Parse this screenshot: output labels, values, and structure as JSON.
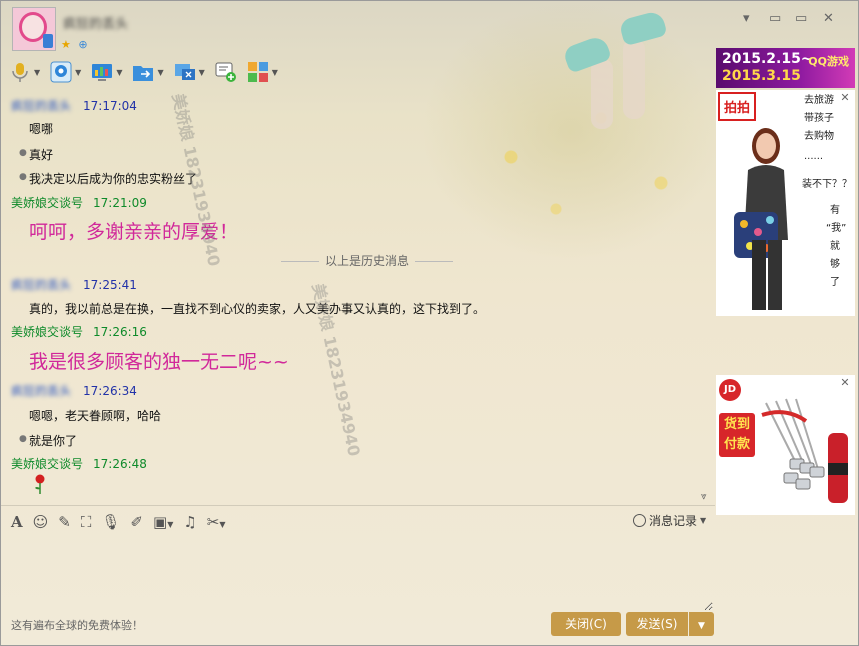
{
  "header": {
    "nickname": "疯狂的丢头",
    "window_controls": [
      "▾",
      "▭",
      "✕"
    ]
  },
  "toolbar_items": [
    {
      "name": "voice-icon"
    },
    {
      "name": "video-icon"
    },
    {
      "name": "remote-assist-icon"
    },
    {
      "name": "file-transfer-icon"
    },
    {
      "name": "screen-share-icon"
    },
    {
      "name": "create-discussion-icon"
    },
    {
      "name": "apps-icon"
    }
  ],
  "messages": [
    {
      "sender": "疯狂的丢头",
      "time": "17:17:04",
      "lines": [
        "嗯哪",
        "真好",
        "我决定以后成为你的忠实粉丝了"
      ]
    },
    {
      "sender": "美娇娘交谈号",
      "time": "17:21:09",
      "big": "呵呵，多谢亲亲的厚爱！"
    },
    {
      "sender": "疯狂的丢头",
      "time": "17:25:41",
      "lines": [
        "真的，我以前总是在换，一直找不到心仪的卖家，人又美办事又认真的，这下找到了。"
      ]
    },
    {
      "sender": "美娇娘交谈号",
      "time": "17:26:16",
      "big": "我是很多顾客的独一无二呢~~"
    },
    {
      "sender": "疯狂的丢头",
      "time": "17:26:34",
      "lines": [
        "嗯嗯，老天眷顾啊，哈哈",
        "就是你了"
      ]
    },
    {
      "sender": "美娇娘交谈号",
      "time": "17:26:48"
    }
  ],
  "history_divider": "以上是历史消息",
  "watermark": [
    "美娇娘 18231934940",
    "美娇娘 18231934940"
  ],
  "ads": {
    "qq_game": {
      "dates_line1": "2015.2.15~",
      "dates_line2": "2015.3.15",
      "logo": "QQ游戏"
    },
    "paipai": {
      "tag": "拍拍",
      "lines": [
        "去旅游",
        "带孩子",
        "去购物",
        "......",
        "装不下？？",
        "有",
        "“我”",
        "就",
        "够",
        "了"
      ]
    },
    "jd": {
      "logo": "JD",
      "promo": "货到付款"
    }
  },
  "edit_toolbar": [
    "font-icon",
    "emoji-icon",
    "magic-icon",
    "screenshot-icon",
    "voice-msg-icon",
    "edit-icon",
    "image-icon",
    "music-icon",
    "cut-icon"
  ],
  "history_button": "消息记录",
  "footer_text": "这有遍布全球的免费体验！",
  "buttons": {
    "close": "关闭(C)",
    "send": "发送(S)"
  }
}
